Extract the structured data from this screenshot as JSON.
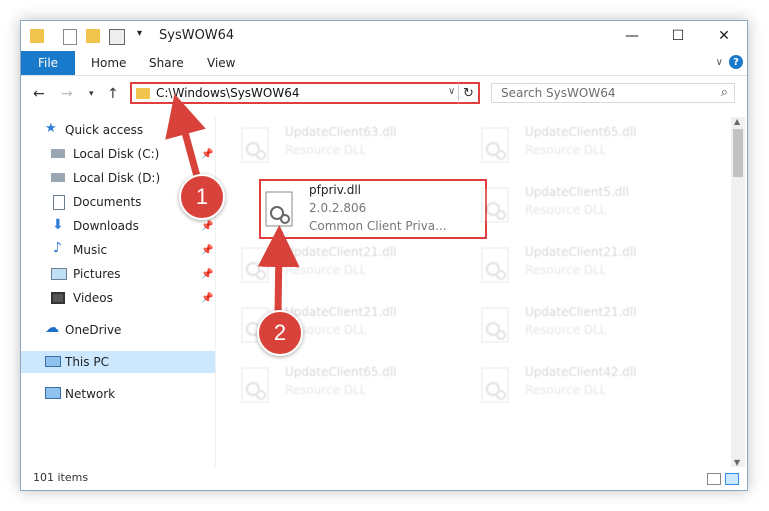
{
  "window": {
    "title": "SysWOW64"
  },
  "ribbon": {
    "file": "File",
    "home": "Home",
    "share": "Share",
    "view": "View"
  },
  "nav": {
    "address_path": "C:\\Windows\\SysWOW64",
    "search_placeholder": "Search SysWOW64"
  },
  "sidebar": {
    "items": [
      {
        "label": "Quick access"
      },
      {
        "label": "Local Disk (C:)"
      },
      {
        "label": "Local Disk (D:)"
      },
      {
        "label": "Documents"
      },
      {
        "label": "Downloads"
      },
      {
        "label": "Music"
      },
      {
        "label": "Pictures"
      },
      {
        "label": "Videos"
      },
      {
        "label": "OneDrive"
      },
      {
        "label": "This PC"
      },
      {
        "label": "Network"
      }
    ]
  },
  "files": {
    "highlighted": {
      "name": "pfpriv.dll",
      "version": "2.0.2.806",
      "description": "Common Client Priva..."
    },
    "others": [
      {
        "name": "UpdateClient63.dll",
        "type": "Resource DLL"
      },
      {
        "name": "UpdateClient65.dll",
        "type": "Resource DLL"
      },
      {
        "name": "UpdateClient5.dll",
        "type": "Resource DLL"
      },
      {
        "name": "UpdateClient21.dll",
        "type": "Resource DLL"
      },
      {
        "name": "UpdateClient21.dll",
        "type": "Resource DLL"
      },
      {
        "name": "UpdateClient21.dll",
        "type": "Resource DLL"
      },
      {
        "name": "UpdateClient21.dll",
        "type": "Resource DLL"
      },
      {
        "name": "UpdateClient65.dll",
        "type": "Resource DLL"
      },
      {
        "name": "UpdateClient42.dll",
        "type": "Resource DLL"
      }
    ]
  },
  "status": {
    "item_count": "101 items"
  },
  "annotations": {
    "step1": "1",
    "step2": "2"
  },
  "colors": {
    "accent": "#1979ca",
    "highlight": "#e13d3d",
    "badge": "#d9423a",
    "selected": "#cce8ff"
  }
}
